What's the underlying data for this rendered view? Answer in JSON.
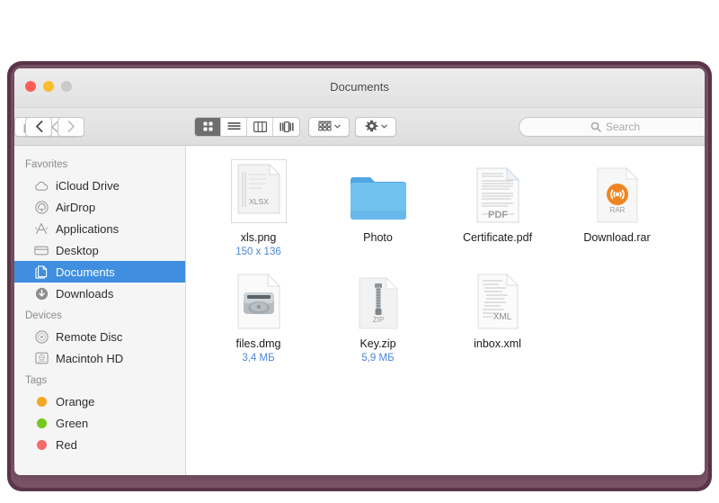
{
  "window": {
    "title": "Documents",
    "traffic_lights": [
      {
        "name": "close",
        "color": "#fc5f57"
      },
      {
        "name": "minimize",
        "color": "#fdbc2c"
      },
      {
        "name": "zoom",
        "color": "#c9c9c9"
      }
    ]
  },
  "toolbar": {
    "back_label": "Back",
    "forward_label": "Forward",
    "view_modes": [
      {
        "name": "icon-view",
        "label": "Icon View",
        "active": true
      },
      {
        "name": "list-view",
        "label": "List View",
        "active": false
      },
      {
        "name": "column-view",
        "label": "Column View",
        "active": false
      },
      {
        "name": "gallery-view",
        "label": "Cover Flow View",
        "active": false
      }
    ],
    "arrange_label": "Arrange",
    "action_label": "Action",
    "share_label": "Share",
    "tag_label": "Edit Tags"
  },
  "search": {
    "placeholder": "Search",
    "value": ""
  },
  "sidebar": {
    "sections": [
      {
        "title": "Favorites",
        "items": [
          {
            "label": "iCloud Drive",
            "icon": "cloud-icon",
            "selected": false
          },
          {
            "label": "AirDrop",
            "icon": "airdrop-icon",
            "selected": false
          },
          {
            "label": "Applications",
            "icon": "applications-icon",
            "selected": false
          },
          {
            "label": "Desktop",
            "icon": "desktop-icon",
            "selected": false
          },
          {
            "label": "Documents",
            "icon": "documents-icon",
            "selected": true
          },
          {
            "label": "Downloads",
            "icon": "downloads-icon",
            "selected": false
          }
        ]
      },
      {
        "title": "Devices",
        "items": [
          {
            "label": "Remote Disc",
            "icon": "disc-icon",
            "selected": false
          },
          {
            "label": "Macintoh HD",
            "icon": "harddisk-icon",
            "selected": false
          }
        ]
      },
      {
        "title": "Tags",
        "items": [
          {
            "label": "Orange",
            "icon": "tag-dot-icon",
            "color": "#f5a623",
            "selected": false
          },
          {
            "label": "Green",
            "icon": "tag-dot-icon",
            "color": "#76c81f",
            "selected": false
          },
          {
            "label": "Red",
            "icon": "tag-dot-icon",
            "color": "#f36a6a",
            "selected": false
          }
        ]
      }
    ]
  },
  "files": [
    {
      "name": "xls.png",
      "meta": "150 x 136",
      "icon": "xlsx-document-icon",
      "badge": "XLSX"
    },
    {
      "name": "Photo",
      "meta": "",
      "icon": "folder-icon",
      "badge": ""
    },
    {
      "name": "Certificate.pdf",
      "meta": "",
      "icon": "pdf-document-icon",
      "badge": "PDF"
    },
    {
      "name": "Download.rar",
      "meta": "",
      "icon": "rar-archive-icon",
      "badge": "RAR"
    },
    {
      "name": "files.dmg",
      "meta": "3,4 МБ",
      "icon": "dmg-disk-image-icon",
      "badge": ""
    },
    {
      "name": "Key.zip",
      "meta": "5,9 МБ",
      "icon": "zip-archive-icon",
      "badge": "ZIP"
    },
    {
      "name": "inbox.xml",
      "meta": "",
      "icon": "xml-document-icon",
      "badge": "XML"
    }
  ],
  "colors": {
    "selection": "#3f8ee0",
    "meta_text": "#4c86d8",
    "backdrop": "#7a5366",
    "folder": "#5cb4ee",
    "rar_badge": "#ef8520"
  }
}
